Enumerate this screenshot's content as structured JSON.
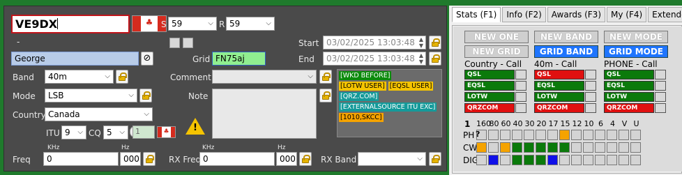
{
  "qso": {
    "callsign": "VE9DX",
    "dash": "-",
    "name": "George",
    "s_label": "S",
    "s_value": "59",
    "r_label": "R",
    "r_value": "59",
    "grid_label": "Grid",
    "grid_value": "FN75aj",
    "start_label": "Start",
    "start_value": "03/02/2025 13:03:48",
    "end_label": "End",
    "end_value": "03/02/2025 13:03:48",
    "band_label": "Band",
    "band_value": "40m",
    "mode_label": "Mode",
    "mode_value": "LSB",
    "country_label": "Country",
    "country_value": "Canada",
    "itu_label": "ITU",
    "itu_value": "9",
    "cq_label": "CQ",
    "cq_value": "5",
    "count_value": "1",
    "comment_label": "Comment",
    "comment_value": "",
    "note_label": "Note",
    "freq_label": "Freq",
    "khz_label": "KHz",
    "hz_label": "Hz",
    "freq_khz": "0",
    "freq_hz": "000",
    "rxfreq_label": "RX Freq",
    "rxfreq_khz": "0",
    "rxfreq_hz": "000",
    "rxband_label": "RX Band",
    "rxband_value": ""
  },
  "info_tags": [
    {
      "text": "[WKD BEFORE]",
      "bg": "#0b8a0b",
      "fg": "#ffffff"
    },
    {
      "text": "[LOTW USER]",
      "bg": "#f5c400",
      "fg": "#000000"
    },
    {
      "text": "[EQSL USER]",
      "bg": "#f5c400",
      "fg": "#000000"
    },
    {
      "text": "[QRZ.COM]",
      "bg": "#149a9a",
      "fg": "#ffffff"
    },
    {
      "text": "[EXTERNALSOURCE ITU EXC]",
      "bg": "#149a9a",
      "fg": "#ffffff"
    },
    {
      "text": "[1010,SKCC]",
      "bg": "#f5a300",
      "fg": "#000000"
    }
  ],
  "tabs": [
    "Stats (F1)",
    "Info (F2)",
    "Awards (F3)",
    "My (F4)",
    "Extended"
  ],
  "stats": {
    "buttons": [
      "NEW ONE",
      "NEW BAND",
      "NEW MODE",
      "NEW GRID",
      "GRID BAND",
      "GRID MODE"
    ],
    "col_headers": [
      "Country - Call",
      "40m - Call",
      "PHONE - Call"
    ],
    "rows": [
      "QSL",
      "EQSL",
      "LOTW",
      "QRZCOM"
    ],
    "status": [
      [
        "g",
        "r",
        "g"
      ],
      [
        "g",
        "g",
        "g"
      ],
      [
        "g",
        "g",
        "g"
      ],
      [
        "r",
        "r",
        "r"
      ]
    ],
    "count": "1",
    "bands": [
      "160",
      "80",
      "60",
      "40",
      "30",
      "20",
      "17",
      "15",
      "12",
      "10",
      "6",
      "4",
      "V",
      "U"
    ],
    "modes": [
      "PH",
      "CW",
      "DIG"
    ],
    "help": "?",
    "grid": [
      [
        "l",
        "l",
        "l",
        "l",
        "l",
        "l",
        "l",
        "o",
        "l",
        "l",
        "l",
        "l",
        "l",
        "l"
      ],
      [
        "o",
        "l",
        "o",
        "g",
        "g",
        "g",
        "g",
        "g",
        "l",
        "l",
        "l",
        "l",
        "l",
        "l"
      ],
      [
        "l",
        "b",
        "l",
        "g",
        "g",
        "g",
        "b",
        "l",
        "l",
        "l",
        "l",
        "l",
        "l",
        "l"
      ]
    ]
  },
  "colors": {
    "accent_green": "#1f7a2c",
    "panel": "#4a4a4a",
    "blue": "#1f75fe",
    "red": "#e01010"
  }
}
